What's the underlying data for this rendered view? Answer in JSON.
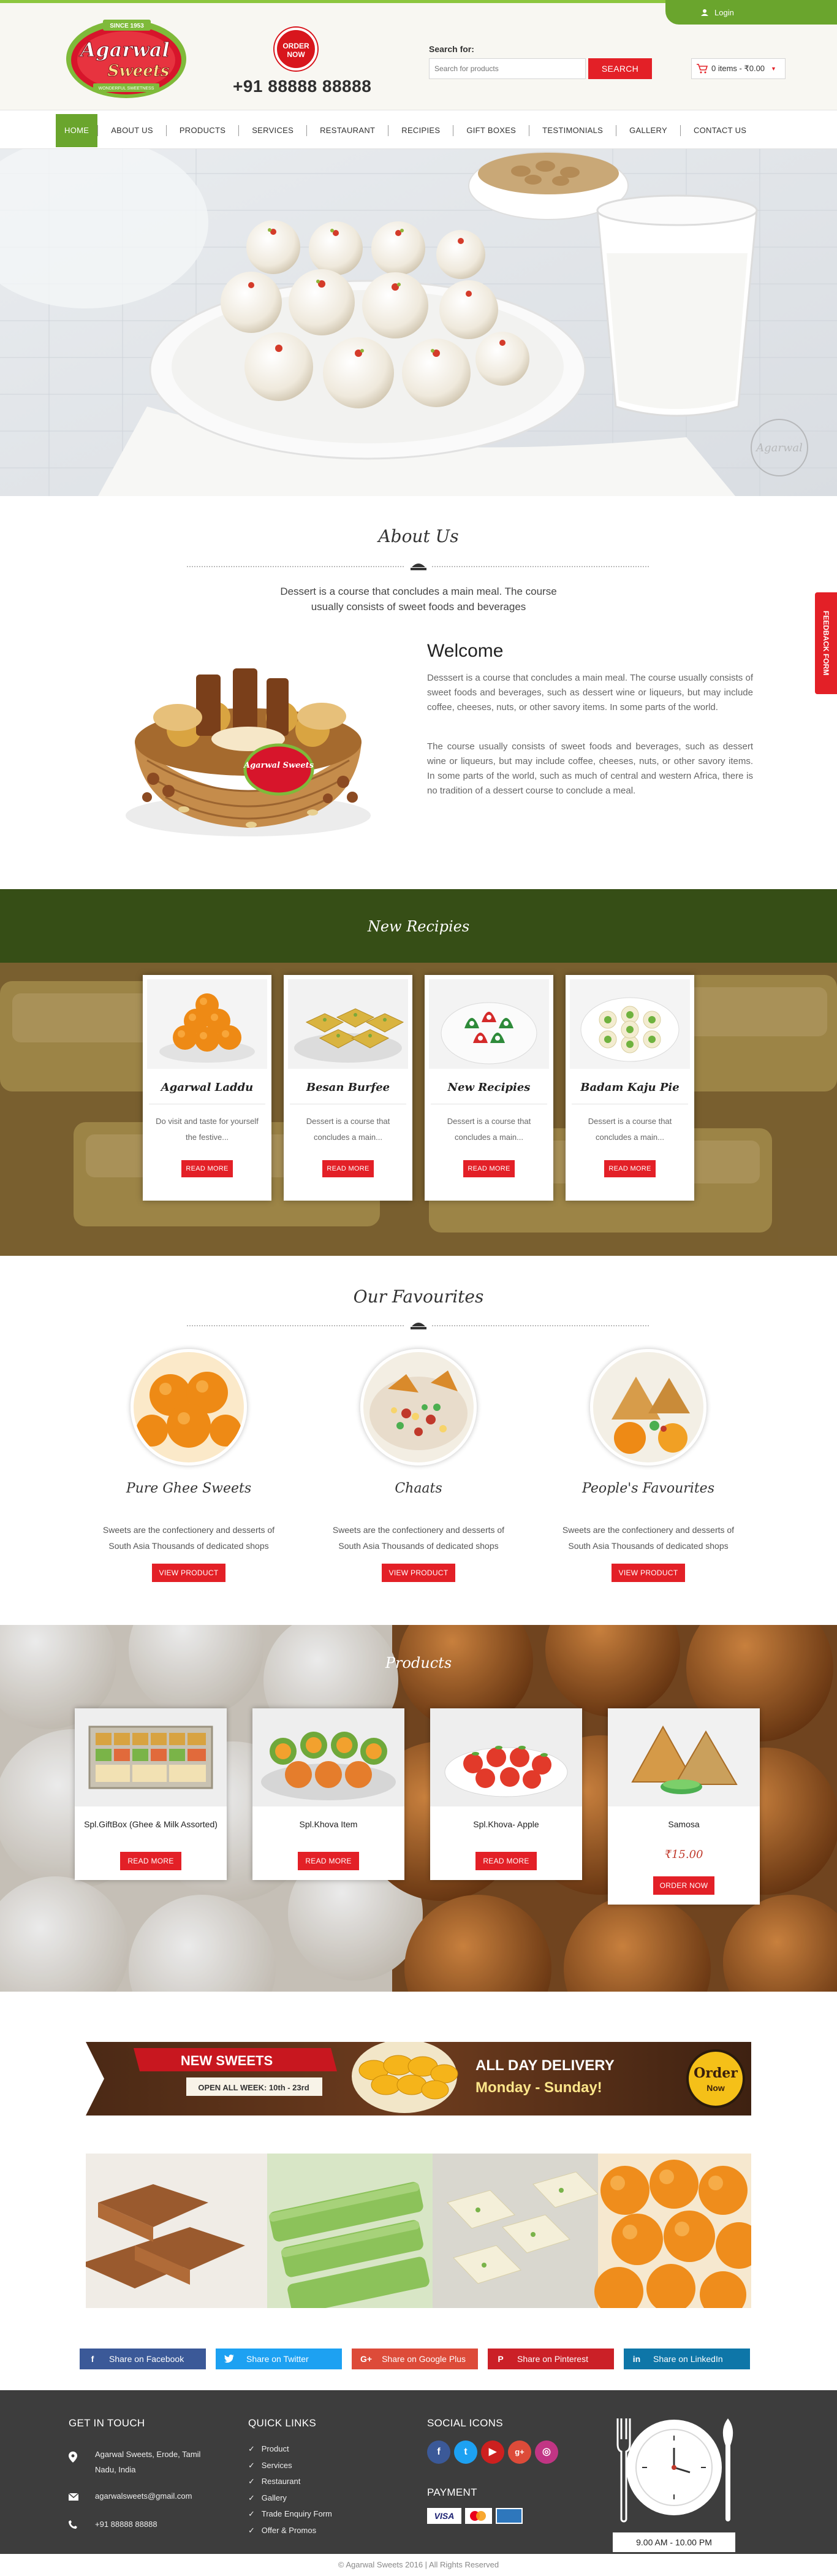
{
  "header": {
    "login_label": "Login",
    "logo_top": "SINCE 1953",
    "logo_line1": "Agarwal",
    "logo_line2": "Sweets",
    "logo_tagline": "WONDERFUL SWEETNESS",
    "order_badge_line1": "ORDER",
    "order_badge_line2": "NOW",
    "phone": "+91 88888 88888",
    "search_label": "Search for:",
    "search_placeholder": "Search for products",
    "search_button": "SEARCH",
    "cart_text": "0 items - ₹0.00"
  },
  "nav": {
    "items": [
      {
        "label": "HOME"
      },
      {
        "label": "ABOUT US"
      },
      {
        "label": "PRODUCTS"
      },
      {
        "label": "SERVICES"
      },
      {
        "label": "RESTAURANT"
      },
      {
        "label": "RECIPIES"
      },
      {
        "label": "GIFT BOXES"
      },
      {
        "label": "TESTIMONIALS"
      },
      {
        "label": "GALLERY"
      },
      {
        "label": "CONTACT US"
      }
    ]
  },
  "hero": {
    "watermark": "Agarwal"
  },
  "about": {
    "title": "About Us",
    "subtitle": "Dessert is a course that concludes a main meal. The course usually consists of sweet foods and beverages",
    "welcome_title": "Welcome",
    "para1": "Desssert is a course that concludes a main meal. The course usually consists of sweet foods and beverages, such as dessert wine or liqueurs, but may include coffee, cheeses, nuts, or other savory items. In some parts of the world.",
    "para2": "The course usually consists of sweet foods and beverages, such as dessert wine or liqueurs, but may include coffee, cheeses, nuts, or other savory items. In some parts of the world, such as much of central and western Africa, there is no tradition of a dessert course to conclude a meal.",
    "basket_label": "Agarwal Sweets"
  },
  "feedback_tab": "FEEDBACK FORM",
  "recipes": {
    "title": "New Recipies",
    "cards": [
      {
        "name": "Agarwal Laddu",
        "desc": "Do visit and taste for yourself the festive...",
        "button": "READ MORE"
      },
      {
        "name": "Besan Burfee",
        "desc": "Dessert is a course that concludes a main...",
        "button": "READ MORE"
      },
      {
        "name": "New Recipies",
        "desc": "Dessert is a course that concludes a main...",
        "button": "READ MORE"
      },
      {
        "name": "Badam Kaju Pie",
        "desc": "Dessert is a course that concludes a main...",
        "button": "READ MORE"
      }
    ]
  },
  "favourites": {
    "title": "Our Favourites",
    "items": [
      {
        "name": "Pure Ghee Sweets",
        "desc": "Sweets are the confectionery and desserts of South Asia Thousands of dedicated shops",
        "button": "VIEW PRODUCT"
      },
      {
        "name": "Chaats",
        "desc": "Sweets are the confectionery and desserts of South Asia Thousands of dedicated shops",
        "button": "VIEW PRODUCT"
      },
      {
        "name": "People's Favourites",
        "desc": "Sweets are the confectionery and desserts of South Asia Thousands of dedicated shops",
        "button": "VIEW PRODUCT"
      }
    ]
  },
  "products": {
    "title": "Products",
    "cards": [
      {
        "name": "Spl.GiftBox (Ghee & Milk Assorted)",
        "button": "READ MORE"
      },
      {
        "name": "Spl.Khova Item",
        "button": "READ MORE"
      },
      {
        "name": "Spl.Khova- Apple",
        "button": "READ MORE"
      },
      {
        "name": "Samosa",
        "price": "₹15.00",
        "button": "ORDER NOW"
      }
    ]
  },
  "banner": {
    "new_sweets": "NEW SWEETS",
    "open_week": "OPEN ALL WEEK: 10th - 23rd",
    "delivery_line1": "ALL DAY DELIVERY",
    "delivery_line2": "Monday - Sunday!",
    "order_line1": "Order",
    "order_line2": "Now"
  },
  "share": [
    {
      "label": "Share on Facebook",
      "color": "#3b5998",
      "icon": "f"
    },
    {
      "label": "Share on Twitter",
      "color": "#1da1f2",
      "icon": "t"
    },
    {
      "label": "Share on Google Plus",
      "color": "#dd4b39",
      "icon": "G+"
    },
    {
      "label": "Share on Pinterest",
      "color": "#cb2027",
      "icon": "P"
    },
    {
      "label": "Share on LinkedIn",
      "color": "#0e76a8",
      "icon": "in"
    }
  ],
  "footer": {
    "get_in_touch": "GET IN TOUCH",
    "address": "Agarwal Sweets, Erode, Tamil Nadu, India",
    "email": "agarwalsweets@gmail.com",
    "phone": "+91 88888 88888",
    "quick_links_title": "QUICK LINKS",
    "quick_links": [
      "Product",
      "Services",
      "Restaurant",
      "Gallery",
      "Trade Enquiry Form",
      "Offer & Promos"
    ],
    "social_title": "SOCIAL ICONS",
    "payment_title": "PAYMENT",
    "payment_visa": "VISA",
    "hours": "9.00 AM - 10.00 PM",
    "copyright": "© Agarwal Sweets 2016 | All Rights Reserved"
  },
  "colors": {
    "brand_green": "#6aa52d",
    "brand_red": "#e32027",
    "footer_dark": "#3d3d3d"
  }
}
